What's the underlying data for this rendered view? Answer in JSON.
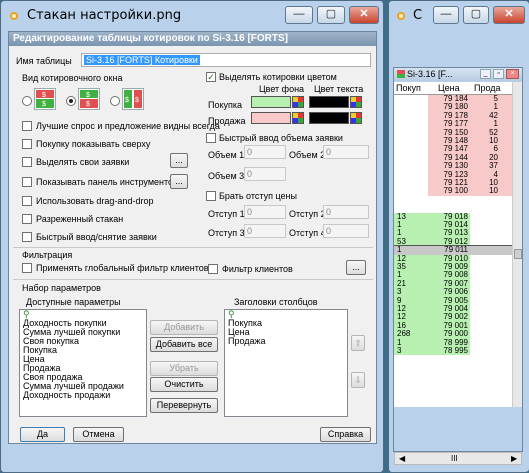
{
  "main_window": {
    "title": "Стакан настройки.png",
    "controls": {
      "minimize": "—",
      "maximize": "▢",
      "close": "✕"
    }
  },
  "dialog": {
    "title": "Редактирование таблицы котировок по Si-3.16 [FORTS]",
    "table_name_label": "Имя таблицы",
    "table_name_value": "Si-3.16 [FORTS] Котировки",
    "view_group_label": "Вид котировочного окна",
    "best_bid_ask_label": "Лучшие спрос и предложение видны всегда",
    "buy_on_top_label": "Покупку показывать сверху",
    "highlight_own_label": "Выделять свои заявки",
    "show_toolbar_label": "Показывать панель инструментов",
    "drag_drop_label": "Использовать drag-and-drop",
    "sparse_label": "Разреженный стакан",
    "quick_entry_label": "Быстрый ввод/снятие заявки",
    "highlight_color_label": "Выделять котировки цветом",
    "bg_color_header": "Цвет фона",
    "text_color_header": "Цвет текста",
    "buy_label": "Покупка",
    "sell_label": "Продажа",
    "quick_volume_label": "Быстрый ввод объема заявки",
    "volume1_label": "Объем 1",
    "volume1_value": "0",
    "volume2_label": "Объем 2",
    "volume2_value": "0",
    "volume3_label": "Объем 3",
    "volume3_value": "0",
    "price_offset_label": "Брать отступ цены",
    "offset1_label": "Отступ 1",
    "offset1_value": "0",
    "offset2_label": "Отступ 2",
    "offset2_value": "0",
    "offset3_label": "Отступ 3",
    "offset3_value": "0",
    "offset4_label": "Отступ 4",
    "offset4_value": "0",
    "ellipsis": "...",
    "filter_section": "Фильтрация",
    "global_filter_label": "Применять глобальный фильтр клиентов",
    "client_filter_label": "Фильтр клиентов",
    "params_section": "Набор параметров",
    "available_params_label": "Доступные параметры",
    "column_headers_label": "Заголовки столбцов",
    "available_params": [
      "Доходность покупки",
      "Сумма лучшей покупки",
      "Своя покупка",
      "Покупка",
      "Цена",
      "Продажа",
      "Своя продажа",
      "Сумма лучшей продажи",
      "Доходность продажи"
    ],
    "columns": [
      "Покупка",
      "Цена",
      "Продажа"
    ],
    "add_button": "Добавить",
    "add_all_button": "Добавить все",
    "remove_button": "Убрать",
    "clear_button": "Очистить",
    "reverse_button": "Перевернуть",
    "ok_button": "Да",
    "cancel_button": "Отмена",
    "help_button": "Справка",
    "colors": {
      "buy_bg": "#b7f0b1",
      "sell_bg": "#f8c9c9",
      "text": "#000000"
    }
  },
  "dom_window": {
    "title": "С",
    "inner_title": "Si-3.16 [F...",
    "headers": {
      "buy": "Покуп",
      "price": "Цена",
      "sell": "Прода"
    },
    "sell_rows": [
      {
        "price": "79 184",
        "vol": "5"
      },
      {
        "price": "79 180",
        "vol": "1"
      },
      {
        "price": "79 178",
        "vol": "42"
      },
      {
        "price": "79 177",
        "vol": "1"
      },
      {
        "price": "79 150",
        "vol": "52"
      },
      {
        "price": "79 148",
        "vol": "10"
      },
      {
        "price": "79 147",
        "vol": "6"
      },
      {
        "price": "79 144",
        "vol": "20"
      },
      {
        "price": "79 130",
        "vol": "37"
      },
      {
        "price": "79 123",
        "vol": "4"
      },
      {
        "price": "79 121",
        "vol": "10"
      },
      {
        "price": "79 100",
        "vol": "10"
      }
    ],
    "buy_rows": [
      {
        "price": "79 018",
        "vol": "13"
      },
      {
        "price": "79 014",
        "vol": "1"
      },
      {
        "price": "79 013",
        "vol": "1"
      },
      {
        "price": "79 012",
        "vol": "53"
      },
      {
        "price": "79 011",
        "vol": "1"
      },
      {
        "price": "79 010",
        "vol": "12"
      },
      {
        "price": "79 009",
        "vol": "35"
      },
      {
        "price": "79 008",
        "vol": "1"
      },
      {
        "price": "79 007",
        "vol": "21"
      },
      {
        "price": "79 006",
        "vol": "3"
      },
      {
        "price": "79 005",
        "vol": "9"
      },
      {
        "price": "79 004",
        "vol": "12"
      },
      {
        "price": "79 002",
        "vol": "12"
      },
      {
        "price": "79 001",
        "vol": "16"
      },
      {
        "price": "79 000",
        "vol": "268"
      },
      {
        "price": "78 999",
        "vol": "1"
      },
      {
        "price": "78 995",
        "vol": "3"
      }
    ],
    "scroll": {
      "left": "◀",
      "right": "▶",
      "grip": "III"
    }
  }
}
